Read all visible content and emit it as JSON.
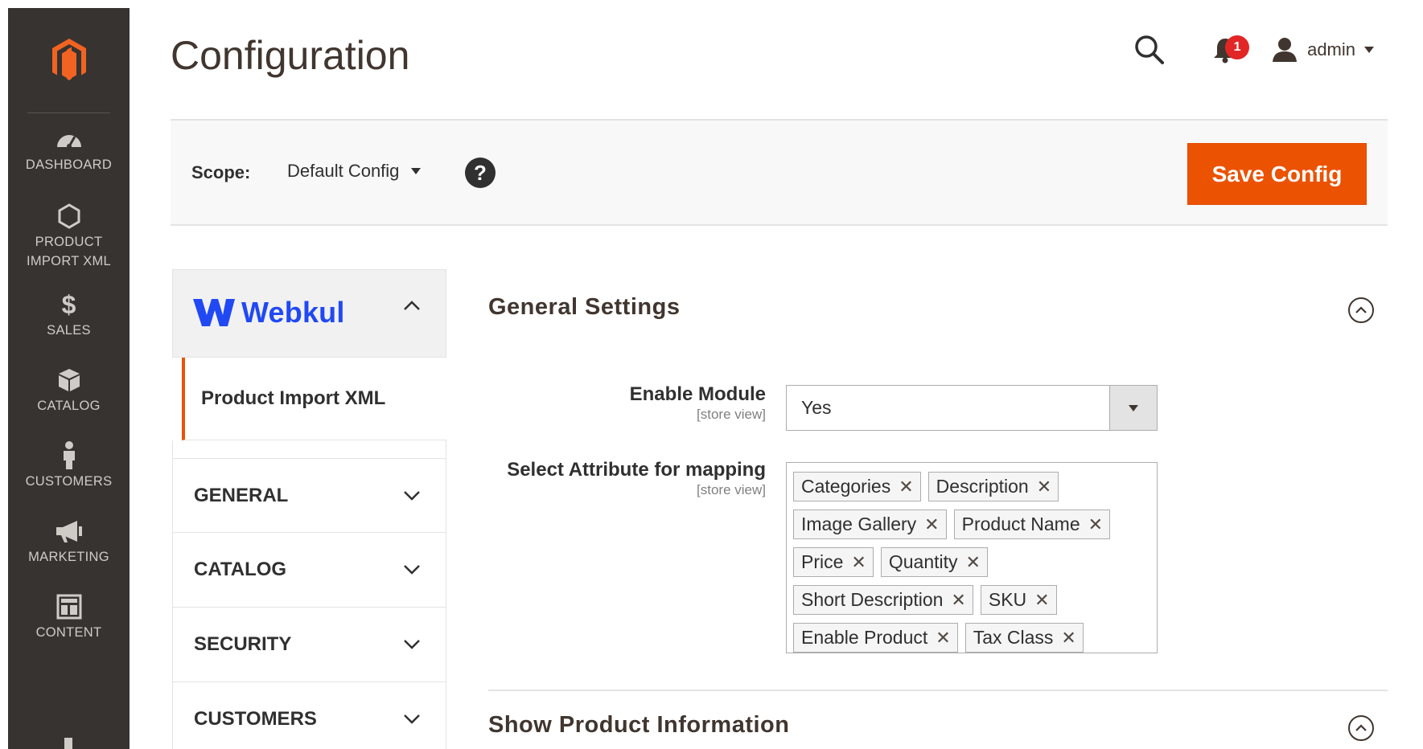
{
  "nav": {
    "items": [
      {
        "label": "DASHBOARD",
        "icon": "dashboard-icon"
      },
      {
        "label": "PRODUCT IMPORT XML",
        "icon": "hexagon-icon"
      },
      {
        "label": "SALES",
        "icon": "dollar-icon"
      },
      {
        "label": "CATALOG",
        "icon": "box-icon"
      },
      {
        "label": "CUSTOMERS",
        "icon": "person-icon"
      },
      {
        "label": "MARKETING",
        "icon": "megaphone-icon"
      },
      {
        "label": "CONTENT",
        "icon": "layout-icon"
      }
    ]
  },
  "header": {
    "title": "Configuration",
    "notification_count": "1",
    "user_name": "admin"
  },
  "scope": {
    "label": "Scope:",
    "value": "Default Config",
    "help": "?",
    "save_label": "Save Config"
  },
  "tabs": {
    "vendor": "Webkul",
    "active_item": "Product Import XML",
    "groups": [
      "GENERAL",
      "CATALOG",
      "SECURITY",
      "CUSTOMERS"
    ]
  },
  "general_settings": {
    "title": "General Settings",
    "enable_module": {
      "label": "Enable Module",
      "scope": "[store view]",
      "value": "Yes"
    },
    "attribute_mapping": {
      "label": "Select Attribute for mapping",
      "scope": "[store view]",
      "rows": [
        [
          "Categories",
          "Description"
        ],
        [
          "Image Gallery",
          "Product Name"
        ],
        [
          "Price",
          "Quantity"
        ],
        [
          "Short Description",
          "SKU"
        ],
        [
          "Enable Product",
          "Tax Class"
        ]
      ]
    }
  },
  "show_product_info": {
    "title": "Show Product Information"
  },
  "colors": {
    "nav_bg": "#373330",
    "accent": "#eb5202",
    "webkul_blue": "#2149f3",
    "badge": "#e22626"
  }
}
